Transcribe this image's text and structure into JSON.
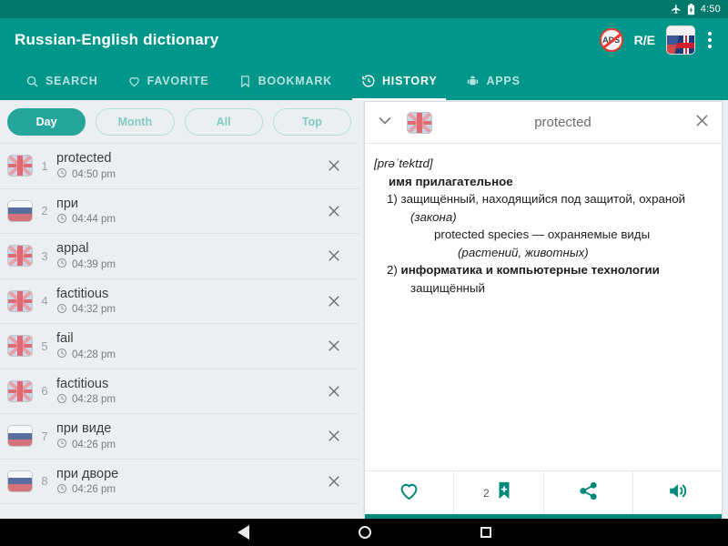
{
  "statusbar": {
    "time": "4:50",
    "airplane_icon": "airplane-icon",
    "battery_icon": "battery-charging-icon"
  },
  "appbar": {
    "title": "Russian-English dictionary",
    "noads_label": "ADS",
    "direction_label": "R/E",
    "flag_icon": "russian-english-flag-icon",
    "overflow_icon": "overflow-menu-icon"
  },
  "tabs": [
    {
      "label": "SEARCH",
      "icon": "search-icon",
      "active": false
    },
    {
      "label": "FAVORITE",
      "icon": "heart-icon",
      "active": false
    },
    {
      "label": "BOOKMARK",
      "icon": "bookmark-icon",
      "active": false
    },
    {
      "label": "HISTORY",
      "icon": "history-icon",
      "active": true
    },
    {
      "label": "APPS",
      "icon": "android-icon",
      "active": false
    }
  ],
  "filters": [
    {
      "label": "Day",
      "active": true
    },
    {
      "label": "Month",
      "active": false
    },
    {
      "label": "All",
      "active": false
    },
    {
      "label": "Top",
      "active": false
    }
  ],
  "history": [
    {
      "index": "1",
      "word": "protected",
      "time": "04:50 pm",
      "lang": "gb"
    },
    {
      "index": "2",
      "word": "при",
      "time": "04:44 pm",
      "lang": "ru"
    },
    {
      "index": "3",
      "word": "appal",
      "time": "04:39 pm",
      "lang": "gb"
    },
    {
      "index": "4",
      "word": "factitious",
      "time": "04:32 pm",
      "lang": "gb"
    },
    {
      "index": "5",
      "word": "fail",
      "time": "04:28 pm",
      "lang": "gb"
    },
    {
      "index": "6",
      "word": "factitious",
      "time": "04:28 pm",
      "lang": "gb"
    },
    {
      "index": "7",
      "word": "при виде",
      "time": "04:26 pm",
      "lang": "ru"
    },
    {
      "index": "8",
      "word": "при дворе",
      "time": "04:26 pm",
      "lang": "ru"
    }
  ],
  "entry": {
    "title": "protected",
    "flag_icon": "uk-flag-icon",
    "collapse_icon": "chevron-down-icon",
    "close_icon": "close-icon",
    "ipa": "[prəˈtektɪd]",
    "part_of_speech": "имя прилагательное",
    "sense1_number": "1)",
    "sense1_text": "защищённый, находящийся под защитой, охраной ",
    "sense1_note": "(закона)",
    "example_text": "protected species — охраняемые виды ",
    "example_note": "(растений, животных)",
    "sense2_number": "2)",
    "sense2_domain": "информатика и компьютерные технологии",
    "sense2_text": "защищённый"
  },
  "entry_actions": {
    "favorite_icon": "heart-icon",
    "bookmark_icon": "bookmark-add-icon",
    "bookmark_count": "2",
    "share_icon": "share-icon",
    "sound_icon": "speaker-icon"
  },
  "navbar": {
    "back_icon": "back-icon",
    "home_icon": "home-icon",
    "recents_icon": "recents-icon"
  },
  "colors": {
    "primary": "#00968A",
    "primary_dark": "#00796B",
    "accent": "#26A69A",
    "action": "#00897B"
  }
}
